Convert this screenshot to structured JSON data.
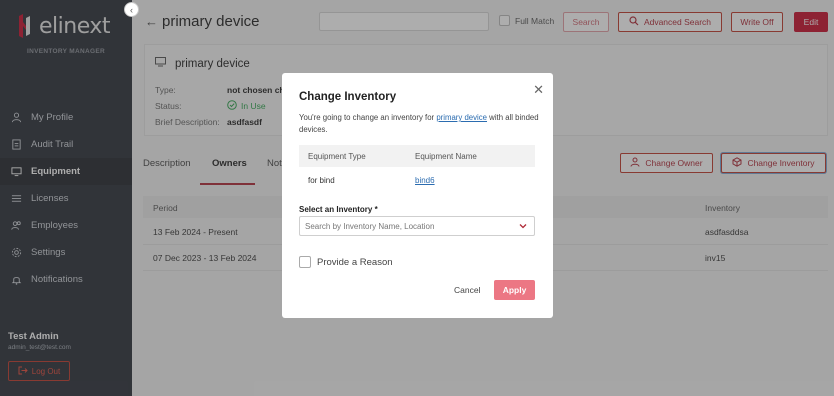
{
  "brand": {
    "name": "elinext",
    "subtitle": "INVENTORY MANAGER",
    "accent": "#c8102e"
  },
  "sidebar": {
    "collapse_icon": "chevron-left-icon",
    "items": [
      {
        "label": "My Profile",
        "icon": "user-icon",
        "active": false
      },
      {
        "label": "Audit Trail",
        "icon": "document-icon",
        "active": false
      },
      {
        "label": "Equipment",
        "icon": "monitor-icon",
        "active": true
      },
      {
        "label": "Licenses",
        "icon": "list-icon",
        "active": false
      },
      {
        "label": "Employees",
        "icon": "users-icon",
        "active": false
      },
      {
        "label": "Settings",
        "icon": "gear-icon",
        "active": false
      },
      {
        "label": "Notifications",
        "icon": "bell-icon",
        "active": false
      }
    ],
    "user": {
      "name": "Test Admin",
      "email": "admin_test@test.com"
    },
    "logout_label": "Log Out"
  },
  "header": {
    "title": "primary device",
    "search_value": "",
    "full_match_label": "Full Match",
    "search_label": "Search",
    "advanced_search_label": "Advanced Search",
    "write_off_label": "Write Off",
    "edit_label": "Edit"
  },
  "device_card": {
    "name": "primary device",
    "type_label": "Type:",
    "type_value": "not chosen ch",
    "status_label": "Status:",
    "status_value": "In Use",
    "brief_label": "Brief Description:",
    "brief_value": "asdfasdf"
  },
  "tabs": [
    {
      "label": "Description"
    },
    {
      "label": "Owners",
      "active": true
    },
    {
      "label": "Not"
    }
  ],
  "actions": {
    "change_owner_label": "Change Owner",
    "change_inventory_label": "Change Inventory"
  },
  "owners_table": {
    "headers": {
      "period": "Period",
      "inventory": "Inventory"
    },
    "rows": [
      {
        "period": "13 Feb 2024 - Present",
        "inventory": "asdfasddsa"
      },
      {
        "period": "07 Dec 2023 - 13 Feb 2024",
        "inventory": "inv15"
      }
    ]
  },
  "modal": {
    "title": "Change Inventory",
    "desc_prefix": "You're going to change an inventory for ",
    "desc_link": "primary device",
    "desc_suffix": " with all binded devices.",
    "table_headers": {
      "type": "Equipment Type",
      "name": "Equipment Name"
    },
    "table_row": {
      "type": "for bind",
      "name": "bind6"
    },
    "select_label": "Select an Inventory *",
    "select_placeholder": "Search by Inventory Name, Location",
    "reason_label": "Provide a Reason",
    "cancel_label": "Cancel",
    "apply_label": "Apply"
  }
}
